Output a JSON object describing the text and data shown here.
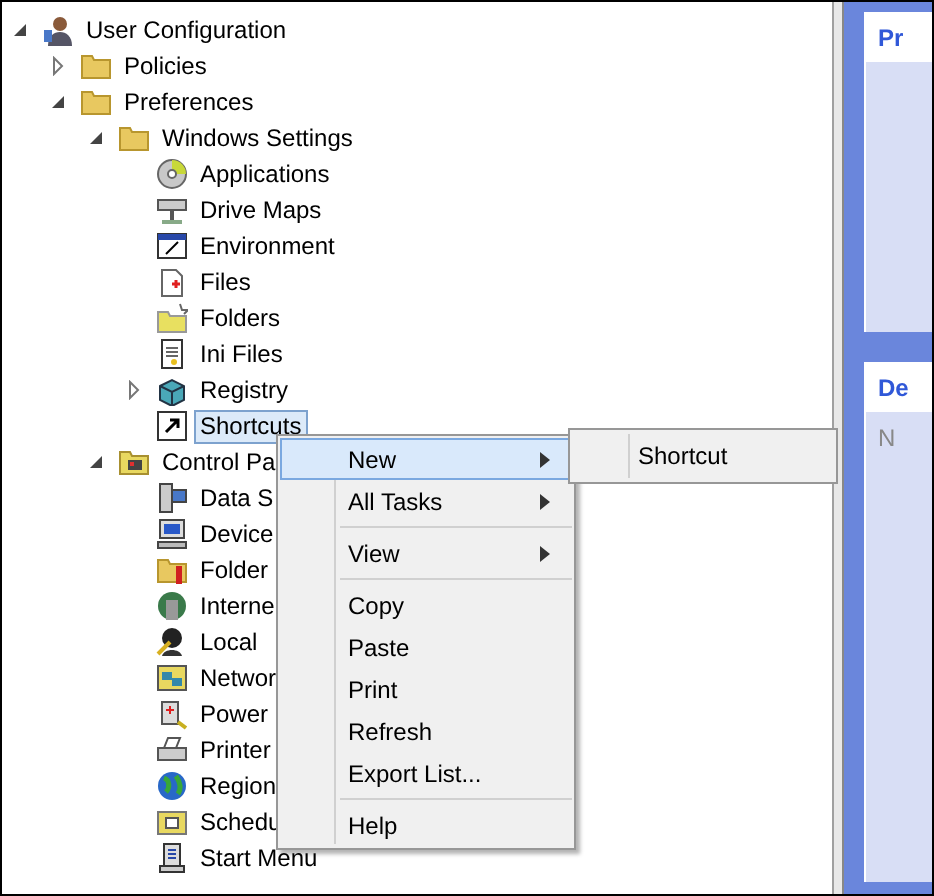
{
  "tree": [
    {
      "label": "User Configuration",
      "expanded": true,
      "selected": false,
      "children": [
        {
          "label": "Policies",
          "expanded": false,
          "selected": false
        },
        {
          "label": "Preferences",
          "expanded": true,
          "selected": false,
          "children": [
            {
              "label": "Windows Settings",
              "expanded": true,
              "selected": false,
              "children": [
                {
                  "label": "Applications",
                  "selected": false
                },
                {
                  "label": "Drive Maps",
                  "selected": false
                },
                {
                  "label": "Environment",
                  "selected": false
                },
                {
                  "label": "Files",
                  "selected": false
                },
                {
                  "label": "Folders",
                  "selected": false
                },
                {
                  "label": "Ini Files",
                  "selected": false
                },
                {
                  "label": "Registry",
                  "expanded": false,
                  "selected": false
                },
                {
                  "label": "Shortcuts",
                  "selected": true
                }
              ]
            },
            {
              "label": "Control Pa",
              "expanded": true,
              "selected": false,
              "children": [
                {
                  "label": "Data S",
                  "selected": false
                },
                {
                  "label": "Device",
                  "selected": false
                },
                {
                  "label": "Folder",
                  "selected": false
                },
                {
                  "label": "Interne",
                  "selected": false
                },
                {
                  "label": "Local",
                  "selected": false
                },
                {
                  "label": "Networ",
                  "selected": false
                },
                {
                  "label": "Power",
                  "selected": false
                },
                {
                  "label": "Printer",
                  "selected": false
                },
                {
                  "label": "Region",
                  "selected": false
                },
                {
                  "label": "Schedu",
                  "selected": false
                },
                {
                  "label": "Start Menu",
                  "selected": false
                }
              ]
            }
          ]
        }
      ]
    }
  ],
  "context_menu": [
    {
      "kind": "item",
      "label": "New",
      "submenu": true,
      "selected": true
    },
    {
      "kind": "item",
      "label": "All Tasks",
      "submenu": true,
      "selected": false
    },
    {
      "kind": "separator"
    },
    {
      "kind": "item",
      "label": "View",
      "submenu": true,
      "selected": false
    },
    {
      "kind": "separator"
    },
    {
      "kind": "item",
      "label": "Copy",
      "submenu": false,
      "selected": false
    },
    {
      "kind": "item",
      "label": "Paste",
      "submenu": false,
      "selected": false
    },
    {
      "kind": "item",
      "label": "Print",
      "submenu": false,
      "selected": false
    },
    {
      "kind": "item",
      "label": "Refresh",
      "submenu": false,
      "selected": false
    },
    {
      "kind": "item",
      "label": "Export List...",
      "submenu": false,
      "selected": false
    },
    {
      "kind": "separator"
    },
    {
      "kind": "item",
      "label": "Help",
      "submenu": false,
      "selected": false
    }
  ],
  "submenu": [
    {
      "label": "Shortcut",
      "selected": false
    }
  ],
  "actions_pane": [
    {
      "title": "Pr"
    },
    {
      "title": "De",
      "text": "N"
    }
  ]
}
